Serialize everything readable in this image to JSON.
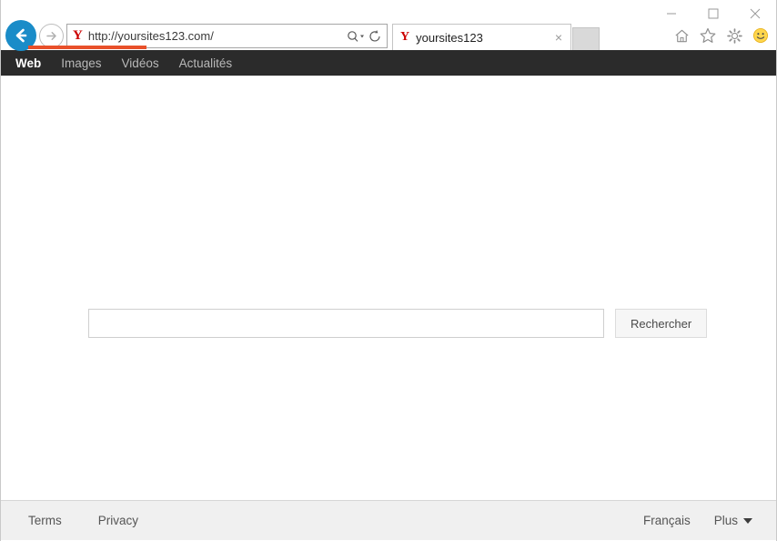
{
  "window": {
    "controls": [
      {
        "name": "minimize",
        "glyph": "minimize-icon"
      },
      {
        "name": "maximize",
        "glyph": "maximize-icon"
      },
      {
        "name": "close",
        "glyph": "close-icon"
      }
    ]
  },
  "chrome": {
    "back_label": "Back",
    "forward_label": "Forward",
    "address": {
      "favicon_letter": "Y",
      "url": "http://yoursites123.com/",
      "placeholder": "http://yoursites123.com/"
    },
    "tab": {
      "favicon_letter": "Y",
      "title": "yoursites123",
      "close_label": "×"
    },
    "new_tab_label": "",
    "tools": [
      {
        "name": "home-icon",
        "label": "Home"
      },
      {
        "name": "favorites-icon",
        "label": "Favorites"
      },
      {
        "name": "settings-icon",
        "label": "Tools"
      },
      {
        "name": "smiley-icon",
        "label": "Send a Smile"
      }
    ],
    "progress_color": "#e8502a"
  },
  "site_nav": {
    "items": [
      {
        "label": "Web",
        "active": true
      },
      {
        "label": "Images",
        "active": false
      },
      {
        "label": "Vidéos",
        "active": false
      },
      {
        "label": "Actualités",
        "active": false
      }
    ]
  },
  "search": {
    "value": "",
    "placeholder": "",
    "button_label": "Rechercher"
  },
  "footer": {
    "left_links": [
      {
        "label": "Terms"
      },
      {
        "label": "Privacy"
      }
    ],
    "language_label": "Français",
    "more_label": "Plus"
  },
  "colors": {
    "nav_bar_bg": "#2b2b2b",
    "back_button_bg": "#1a8cc8",
    "footer_bg": "#f0f0f0",
    "favicon_red": "#cc0000",
    "progress": "#e8502a"
  }
}
